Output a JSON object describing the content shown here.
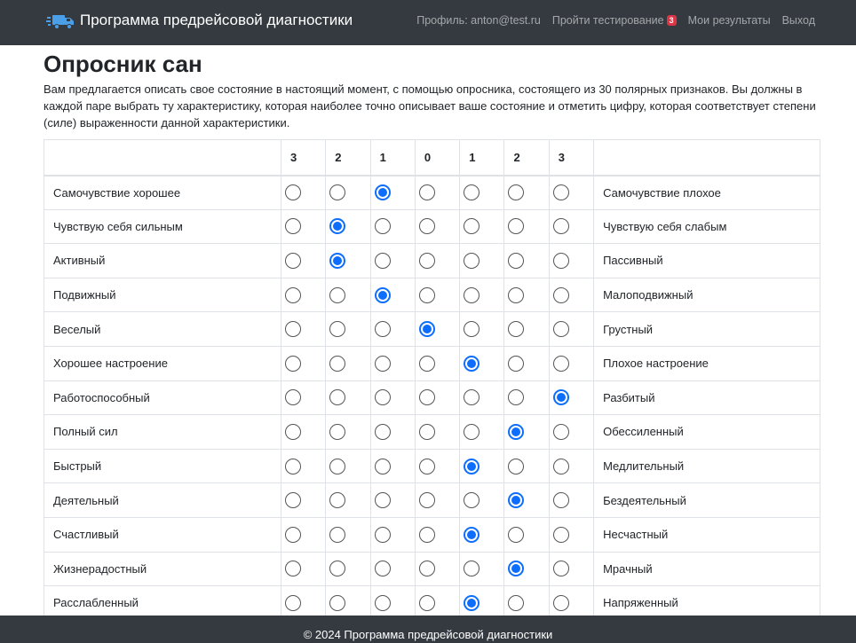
{
  "navbar": {
    "brand": "Программа предрейсовой диагностики",
    "profile": "Профиль: anton@test.ru",
    "take_test": "Пройти тестирование",
    "take_test_badge": "3",
    "my_results": "Мои результаты",
    "logout": "Выход"
  },
  "page": {
    "title": "Опросник сан",
    "intro": "Вам предлагается описать свое состояние в настоящий момент, с помощью опросника, состоящего из 30 полярных признаков. Вы должны в каждой паре выбрать ту характеристику, которая наиболее точно описывает ваше состояние и отметить цифру, которая соответствует степени (силе) выраженности данной характеристики."
  },
  "table": {
    "scale": [
      "3",
      "2",
      "1",
      "0",
      "1",
      "2",
      "3"
    ],
    "rows": [
      {
        "left": "Самочувствие хорошее",
        "right": "Самочувствие плохое",
        "selected": 2
      },
      {
        "left": "Чувствую себя сильным",
        "right": "Чувствую себя слабым",
        "selected": 1
      },
      {
        "left": "Активный",
        "right": "Пассивный",
        "selected": 1
      },
      {
        "left": "Подвижный",
        "right": "Малоподвижный",
        "selected": 2
      },
      {
        "left": "Веселый",
        "right": "Грустный",
        "selected": 3
      },
      {
        "left": "Хорошее настроение",
        "right": "Плохое настроение",
        "selected": 4
      },
      {
        "left": "Работоспособный",
        "right": "Разбитый",
        "selected": 6
      },
      {
        "left": "Полный сил",
        "right": "Обессиленный",
        "selected": 5
      },
      {
        "left": "Быстрый",
        "right": "Медлительный",
        "selected": 4
      },
      {
        "left": "Деятельный",
        "right": "Бездеятельный",
        "selected": 5
      },
      {
        "left": "Счастливый",
        "right": "Несчастный",
        "selected": 4
      },
      {
        "left": "Жизнерадостный",
        "right": "Мрачный",
        "selected": 5
      },
      {
        "left": "Расслабленный",
        "right": "Напряженный",
        "selected": 4
      }
    ]
  },
  "footer": {
    "text": "© 2024 Программа предрейсовой диагностики"
  },
  "colors": {
    "navbar": "#343a40",
    "accent": "#0d6efd",
    "badge": "#dc3545"
  }
}
